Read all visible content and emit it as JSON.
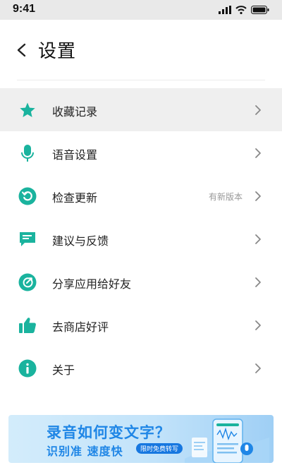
{
  "status": {
    "time": "9:41"
  },
  "header": {
    "title": "设置"
  },
  "menu": {
    "items": [
      {
        "label": "收藏记录",
        "badge": ""
      },
      {
        "label": "语音设置",
        "badge": ""
      },
      {
        "label": "检查更新",
        "badge": "有新版本"
      },
      {
        "label": "建议与反馈",
        "badge": ""
      },
      {
        "label": "分享应用给好友",
        "badge": ""
      },
      {
        "label": "去商店好评",
        "badge": ""
      },
      {
        "label": "关于",
        "badge": ""
      }
    ]
  },
  "banner": {
    "title": "录音如何变文字？",
    "subtitle": "识别准  速度快",
    "tag": "限时免费转写"
  },
  "colors": {
    "accent": "#1ab39e",
    "banner_blue": "#1f86e6"
  }
}
